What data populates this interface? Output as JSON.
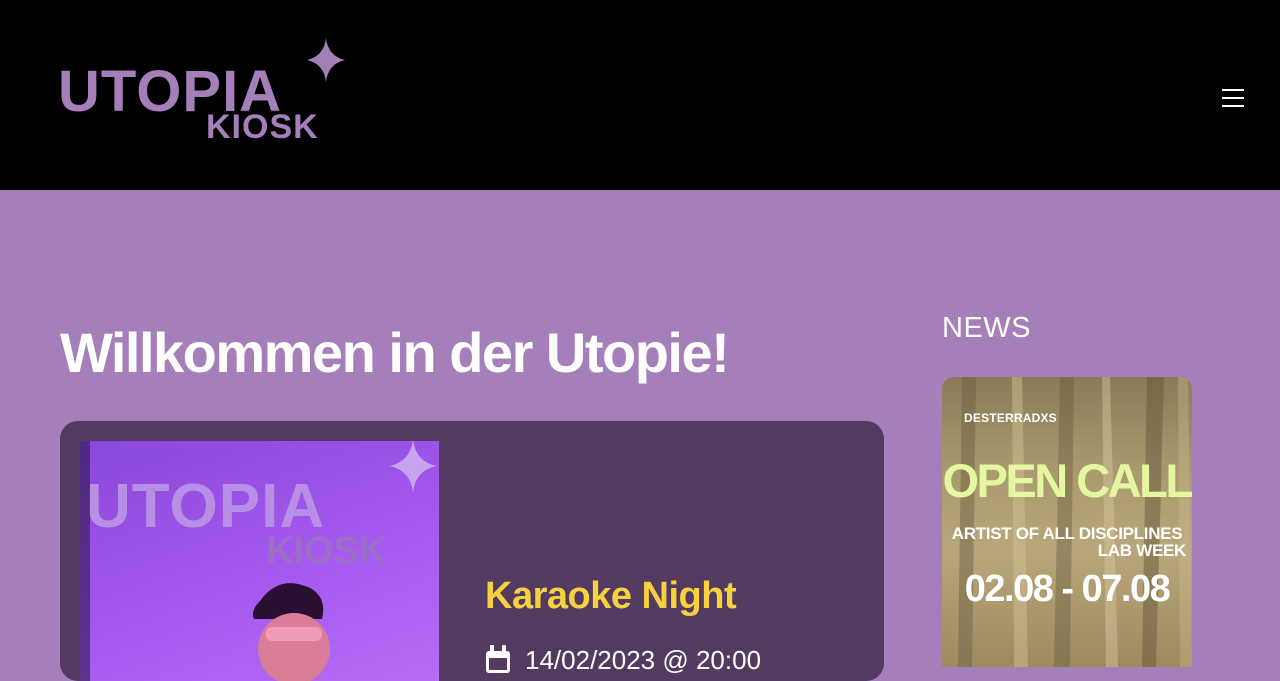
{
  "header": {
    "logo": {
      "line1": "UTOPIA",
      "line2": "KIOSK",
      "color": "#a47fba"
    },
    "menu_icon": "hamburger-menu-icon"
  },
  "main": {
    "title": "Willkommen in der Utopie!",
    "event": {
      "title": "Karaoke Night",
      "date": "14/02/2023 @ 20:00",
      "date_icon": "calendar-icon",
      "image": {
        "logo_line1": "UTOPIA",
        "logo_line2": "KIOSK"
      }
    }
  },
  "sidebar": {
    "heading": "NEWS",
    "news_item": {
      "brand": "DESTERRADXS",
      "headline": "OPEN CALL",
      "line1": "ARTIST OF ALL DISCIPLINES",
      "line2": "LAB WEEK",
      "dates": "02.08 - 07.08"
    }
  },
  "colors": {
    "background": "#a47fba",
    "header": "#000000",
    "card": "#533a61",
    "accent": "#f7d23e"
  }
}
